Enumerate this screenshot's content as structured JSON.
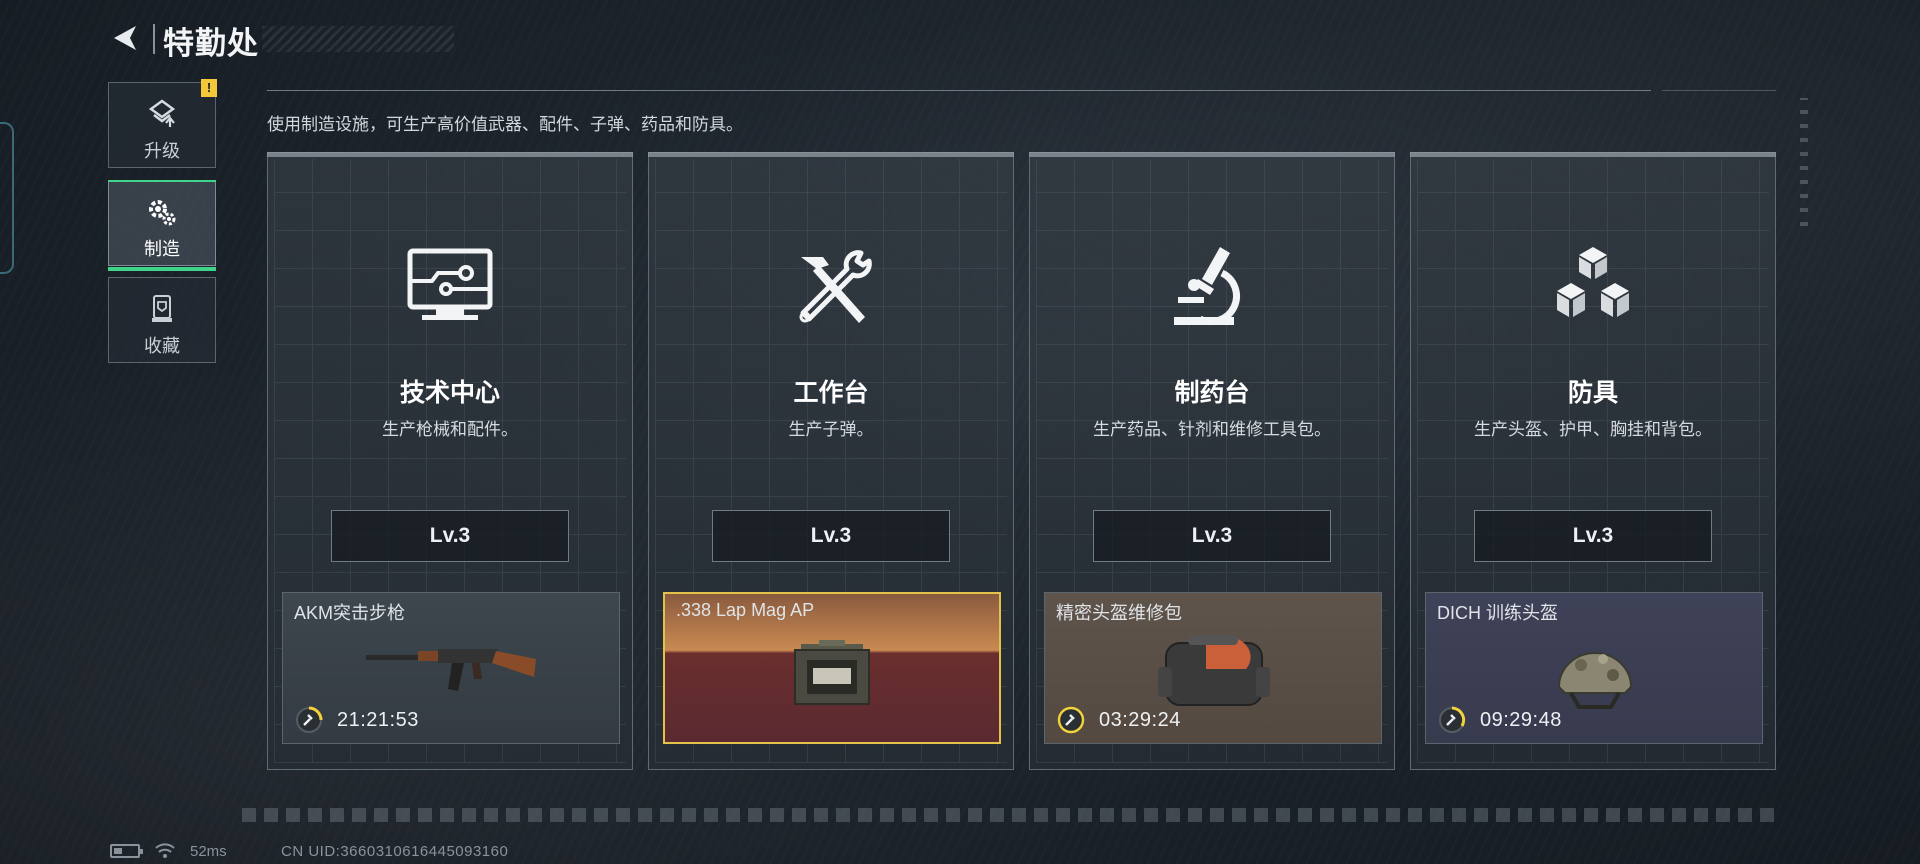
{
  "header": {
    "title": "特勤处"
  },
  "sidebar": {
    "items": [
      {
        "label": "升级",
        "icon": "upgrade-icon",
        "alert": "!"
      },
      {
        "label": "制造",
        "icon": "gear-icon",
        "active": true
      },
      {
        "label": "收藏",
        "icon": "trophy-icon"
      }
    ]
  },
  "description": "使用制造设施，可生产高价值武器、配件、子弹、药品和防具。",
  "cards": [
    {
      "name": "技术中心",
      "desc": "生产枪械和配件。",
      "level": "Lv.3",
      "icon": "monitor-circuit-icon",
      "item": {
        "name": "AKM突击步枪",
        "timer": "21:21:53",
        "image": "rifle-icon",
        "rarity": "gray"
      }
    },
    {
      "name": "工作台",
      "desc": "生产子弹。",
      "level": "Lv.3",
      "icon": "hammer-wrench-icon",
      "item": {
        "name": ".338 Lap Mag AP",
        "timer": "",
        "image": "ammo-box-icon",
        "rarity": "orange"
      }
    },
    {
      "name": "制药台",
      "desc": "生产药品、针剂和维修工具包。",
      "level": "Lv.3",
      "icon": "microscope-icon",
      "item": {
        "name": "精密头盔维修包",
        "timer": "03:29:24",
        "image": "repair-bag-icon",
        "rarity": "brown"
      }
    },
    {
      "name": "防具",
      "desc": "生产头盔、护甲、胸挂和背包。",
      "level": "Lv.3",
      "icon": "cubes-icon",
      "item": {
        "name": "DICH 训练头盔",
        "timer": "09:29:48",
        "image": "helmet-icon",
        "rarity": "purple"
      }
    }
  ],
  "status": {
    "ping": "52ms",
    "uid": "CN UID:3660310616445093160"
  },
  "colors": {
    "accent": "#3fd48a",
    "alert": "#f3c93b",
    "gold_border": "#e2c24a",
    "timer_ring": "#f3d23b"
  }
}
